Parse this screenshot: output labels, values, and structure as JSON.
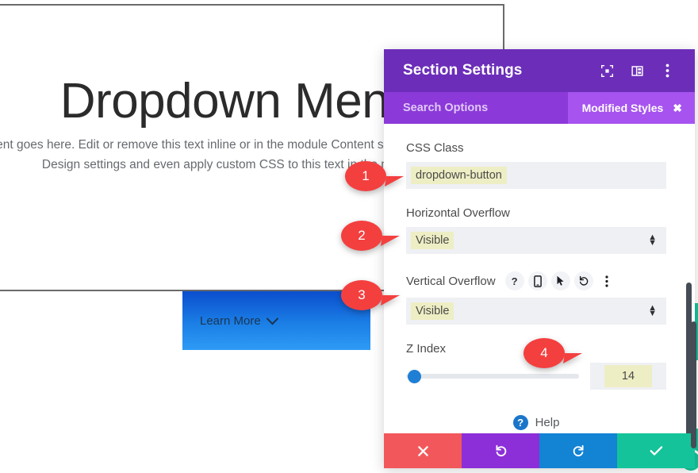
{
  "page": {
    "hero_title": "Dropdown Menu",
    "hero_body": "ent goes here. Edit or remove this text inline or in the module Content settings. module Design settings and even apply custom CSS to this text in the module",
    "learn_more_label": "Learn More"
  },
  "modal": {
    "title": "Section Settings",
    "header_icons": [
      {
        "name": "fullscreen-icon"
      },
      {
        "name": "layout-panel-icon"
      },
      {
        "name": "more-vertical-icon"
      }
    ],
    "search": {
      "placeholder": "Search Options",
      "value": ""
    },
    "modified_styles": {
      "label": "Modified Styles",
      "close": "✖"
    },
    "fields": [
      {
        "label": "CSS Class",
        "type": "text",
        "value": "dropdown-button",
        "highlighted": true
      },
      {
        "label": "Horizontal Overflow",
        "type": "select",
        "value": "Visible",
        "highlighted": true
      },
      {
        "label": "Vertical Overflow",
        "type": "select",
        "value": "Visible",
        "highlighted": true,
        "icons": [
          {
            "name": "help-question-icon",
            "glyph": "?"
          },
          {
            "name": "responsive-mobile-icon",
            "glyph": ""
          },
          {
            "name": "hover-cursor-icon",
            "glyph": ""
          },
          {
            "name": "reset-undo-icon",
            "glyph": ""
          },
          {
            "name": "more-options-icon",
            "glyph": ""
          }
        ]
      }
    ],
    "zindex": {
      "label": "Z Index",
      "value": "14",
      "slider_percent": 0
    },
    "help": {
      "label": "Help",
      "icon_glyph": "?"
    },
    "footer_buttons": [
      {
        "name": "cancel-button",
        "glyph": "✖",
        "color": "#f2585b"
      },
      {
        "name": "undo-button",
        "glyph": "↺",
        "color": "#8c2fd8"
      },
      {
        "name": "redo-button",
        "glyph": "↻",
        "color": "#1383d4"
      },
      {
        "name": "save-button",
        "glyph": "✔",
        "color": "#15c39a"
      }
    ]
  },
  "markers": [
    {
      "number": "1"
    },
    {
      "number": "2"
    },
    {
      "number": "3"
    },
    {
      "number": "4"
    }
  ],
  "colors": {
    "header_purple": "#6c2eb9",
    "search_purple": "#8c39d9",
    "badge_purple": "#a653ef",
    "highlight_yellow": "#eeeec4",
    "input_gray": "#eef0f4",
    "marker_red": "#f43f3f",
    "teal": "#15c39a",
    "slider_blue": "#1f7fd4"
  }
}
